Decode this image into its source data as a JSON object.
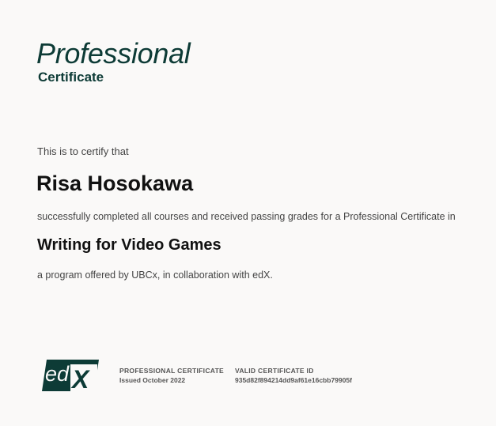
{
  "header": {
    "title": "Professional",
    "subtitle": "Certificate"
  },
  "certificate": {
    "intro": "This is to certify that",
    "recipient": "Risa Hosokawa",
    "completion_text": "successfully completed all courses and received passing grades for a Professional Certificate in",
    "course_title": "Writing for Video Games",
    "offered_by": "a program offered by UBCx, in collaboration with edX."
  },
  "footer": {
    "logo": {
      "text_ed": "ed",
      "text_x": "X",
      "color": "#0d3b36"
    },
    "type_label": "PROFESSIONAL CERTIFICATE",
    "issued": "Issued October 2022",
    "id_label": "VALID CERTIFICATE ID",
    "id_value": "935d82f894214dd9af61e16cbb79905f"
  }
}
